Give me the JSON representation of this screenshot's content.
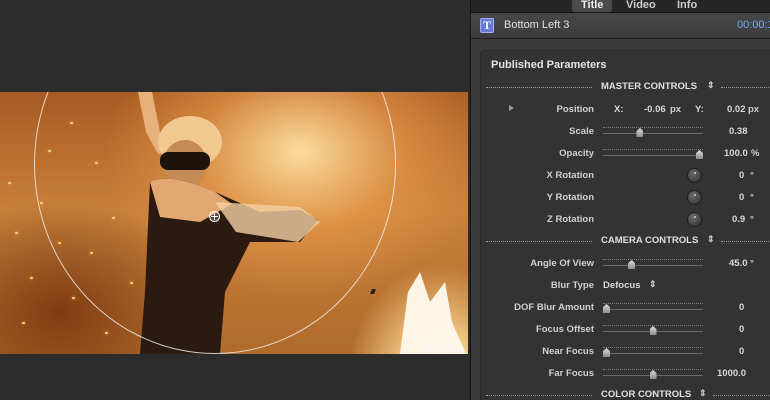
{
  "tabs": [
    {
      "label": "Title",
      "active": true
    },
    {
      "label": "Video",
      "active": false
    },
    {
      "label": "Info",
      "active": false
    }
  ],
  "header": {
    "icon": "title-T-icon",
    "clip_name": "Bottom Left 3",
    "timecode": "00:00:1"
  },
  "panel": {
    "title": "Published Parameters"
  },
  "sections": {
    "master": "MASTER CONTROLS",
    "camera": "CAMERA CONTROLS",
    "color": "COLOR CONTROLS"
  },
  "params": {
    "position": {
      "label": "Position",
      "x_label": "X:",
      "x_value": "-0.06",
      "x_unit": "px",
      "y_label": "Y:",
      "y_value": "0.02",
      "y_unit": "px"
    },
    "scale": {
      "label": "Scale",
      "value": "0.38",
      "level": 0.36
    },
    "opacity": {
      "label": "Opacity",
      "value": "100.0",
      "unit": "%",
      "level": 1.0
    },
    "x_rotation": {
      "label": "X Rotation",
      "value": "0",
      "unit": "°"
    },
    "y_rotation": {
      "label": "Y Rotation",
      "value": "0",
      "unit": "°"
    },
    "z_rotation": {
      "label": "Z Rotation",
      "value": "0.9",
      "unit": "°"
    },
    "angle_of_view": {
      "label": "Angle Of View",
      "value": "45.0",
      "unit": "°",
      "level": 0.27
    },
    "blur_type": {
      "label": "Blur Type",
      "value": "Defocus"
    },
    "dof_blur": {
      "label": "DOF Blur Amount",
      "value": "0",
      "level": 0.0
    },
    "focus_offset": {
      "label": "Focus Offset",
      "value": "0",
      "level": 0.5
    },
    "near_focus": {
      "label": "Near Focus",
      "value": "0",
      "level": 0.0
    },
    "far_focus": {
      "label": "Far Focus",
      "value": "1000.0",
      "level": 0.5
    }
  },
  "icons": {
    "disclosure": "disclosure-triangle-icon",
    "updown": "up-down-arrows-icon"
  },
  "colors": {
    "timecode": "#78a8ff",
    "title_icon": "#6a7ad8"
  }
}
